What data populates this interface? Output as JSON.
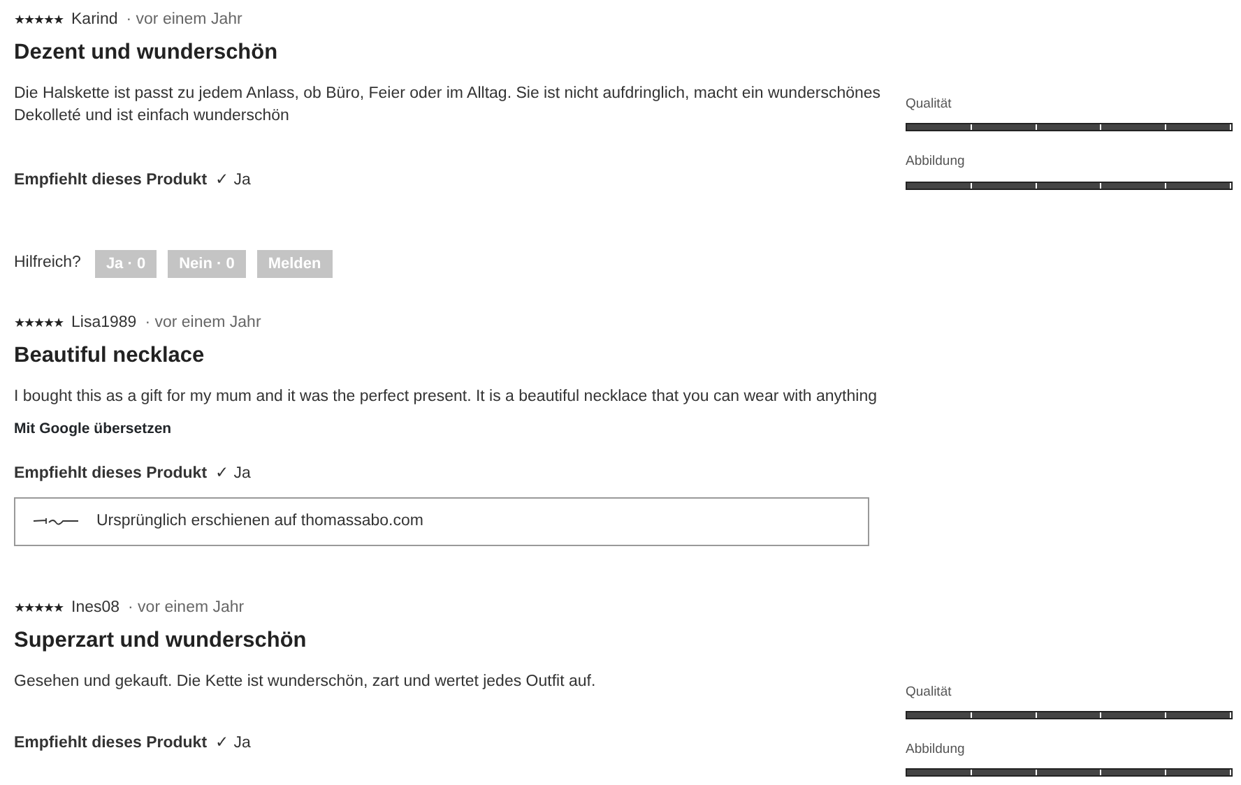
{
  "reviews": [
    {
      "stars": 5,
      "author": "Karind",
      "date": "· vor einem Jahr",
      "title": "Dezent und wunderschön",
      "text": "Die Halskette ist passt zu jedem Anlass, ob Büro, Feier oder im Alltag. Sie ist nicht aufdringlich, macht ein wunderschönes Dekolleté und ist einfach wunderschön",
      "recommend_label": "Empfiehlt dieses Produkt",
      "recommend_value": "✓ Ja",
      "helpful": {
        "label": "Hilfreich?",
        "buttons": [
          "Ja · 0",
          "Nein · 0",
          "Melden"
        ]
      },
      "ratings": [
        {
          "label": "Qualität",
          "level": 1
        },
        {
          "label": "Abbildung",
          "level": 1
        }
      ]
    },
    {
      "stars": 5,
      "author": "Lisa1989",
      "date": "· vor einem Jahr",
      "title": "Beautiful necklace",
      "text": "I bought this as a gift for my mum and it was the perfect present. It is a beautiful necklace that you can wear with anything",
      "translate": "Mit Google übersetzen",
      "recommend_label": "Empfiehlt dieses Produkt",
      "recommend_value": "✓ Ja",
      "source": "Ursprünglich erschienen auf thomassabo.com"
    },
    {
      "stars": 5,
      "author": "Ines08",
      "date": "· vor einem Jahr",
      "title": "Superzart und wunderschön",
      "text": "Gesehen und gekauft. Die Kette ist wunderschön, zart und wertet jedes Outfit auf.",
      "recommend_label": "Empfiehlt dieses Produkt",
      "recommend_value": "✓ Ja",
      "ratings": [
        {
          "label": "Qualität",
          "level": 1
        },
        {
          "label": "Abbildung",
          "level": 1
        }
      ]
    }
  ]
}
